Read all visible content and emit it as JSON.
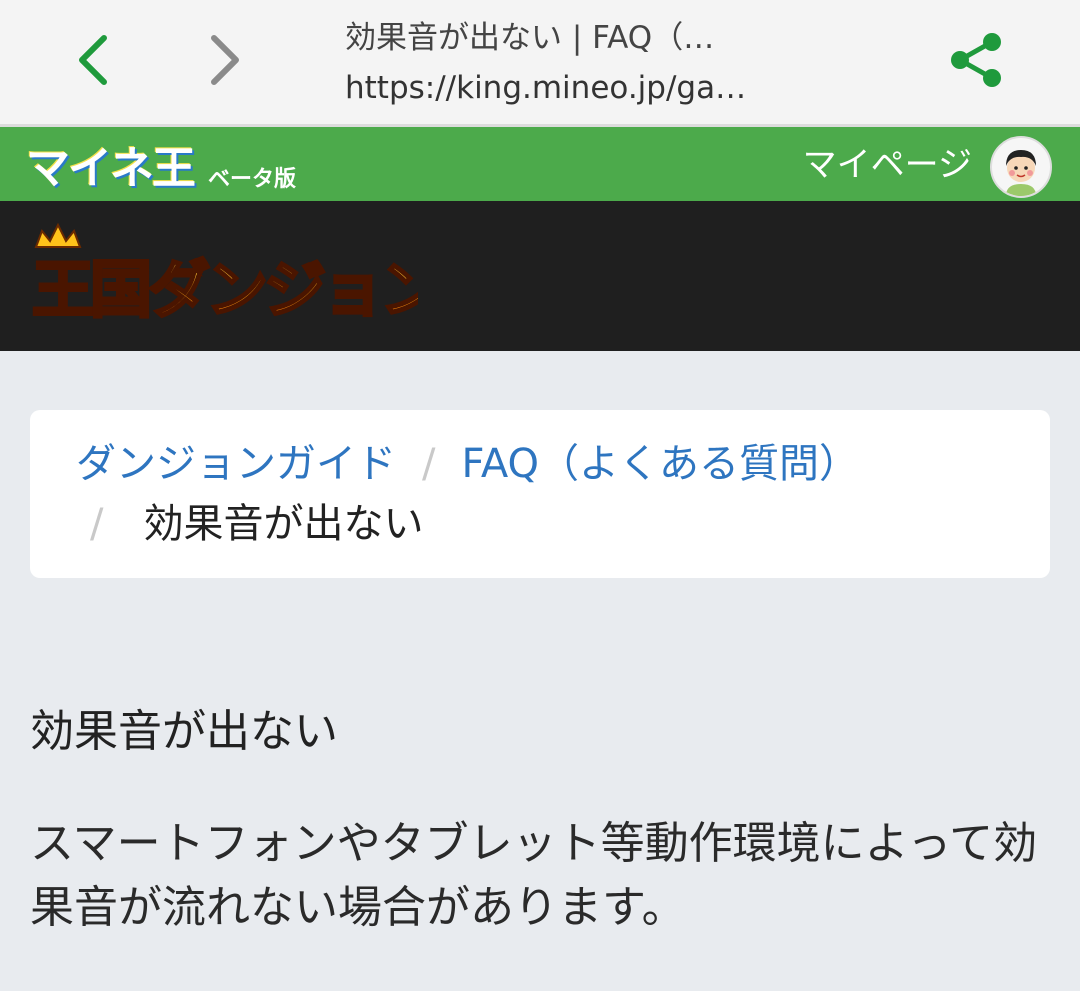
{
  "browser": {
    "page_title": "効果音が出ない | FAQ（…",
    "url": "https://king.mineo.jp/ga…"
  },
  "header": {
    "logo": "マイネ王",
    "beta_label": "ベータ版",
    "mypage_label": "マイページ",
    "accent_color": "#4caa4b"
  },
  "banner": {
    "logo_text": "王国ダンジョン"
  },
  "breadcrumb": {
    "item1": "ダンジョンガイド",
    "separator": "/",
    "item2": "FAQ（よくある質問）",
    "current": "効果音が出ない"
  },
  "content": {
    "title": "効果音が出ない",
    "body": "スマートフォンやタブレット等動作環境によって効果音が流れない場合があります。"
  },
  "icons": {
    "back": "chevron-left-icon",
    "forward": "chevron-right-icon",
    "share": "share-icon"
  }
}
